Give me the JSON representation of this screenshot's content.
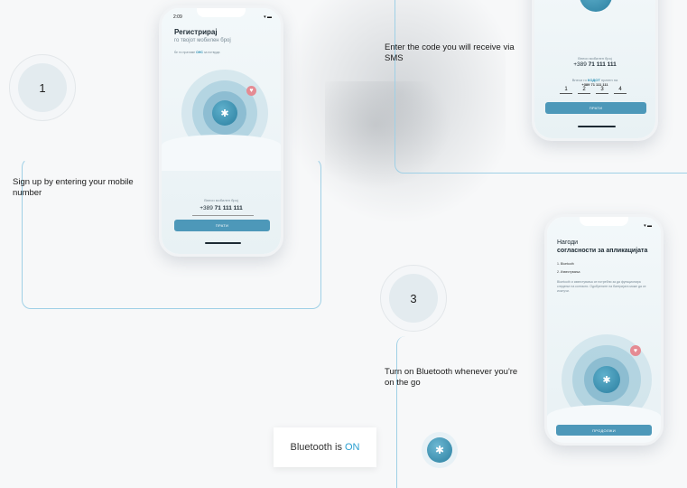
{
  "steps": {
    "step1_number": "1",
    "step3_number": "3"
  },
  "captions": {
    "step1": "Sign up by entering your mobile number",
    "step2": "Enter the code you will receive via SMS",
    "step3": "Turn on Bluetooth whenever you're on the go"
  },
  "phone1": {
    "time": "2:09",
    "signal": "▾ ▬",
    "title": "Регистрирај",
    "subtitle": "го твојот мобилен број",
    "note_prefix": "Ќе ти пратиме ",
    "note_highlight": "ОНС",
    "note_suffix": " за потврда",
    "field_label": "Внеси мобилен број",
    "field_prefix": "+389 ",
    "field_value": "71 111 111",
    "button": "ПРАТИ"
  },
  "phone2": {
    "field_label": "Внеси мобилен број",
    "field_prefix": "+389 ",
    "field_value": "71 111 111",
    "code_note_prefix": "Внеси го ",
    "code_note_highlight": "КОДОТ",
    "code_note_suffix": " пратен на",
    "code_note_number": "+389 71 111 111",
    "code_digits": [
      "1",
      "2",
      "3",
      "4"
    ],
    "button": "ПРАТИ"
  },
  "phone3": {
    "signal": "▾ ▬",
    "title_line1": "Нагоди",
    "title_line2": "согласности за апликацијата",
    "item1": "1. Bluetooth",
    "item2": "2. Известувања",
    "description": "Bluetooth и известувања се потребни за да функционира следење на контакти. Одобрените на батеријата може да се исклучи.",
    "button": "ПРОДОЛЖИ"
  },
  "bluetooth_card": {
    "prefix": "Bluetooth is",
    "state": "ON"
  },
  "colors": {
    "accent": "#2a9fd0",
    "button": "#4d98b9",
    "frame": "#9fd0e6",
    "heart": "#e58b93"
  },
  "icons": {
    "bluetooth": "bluetooth-icon",
    "heart": "heart-icon"
  }
}
